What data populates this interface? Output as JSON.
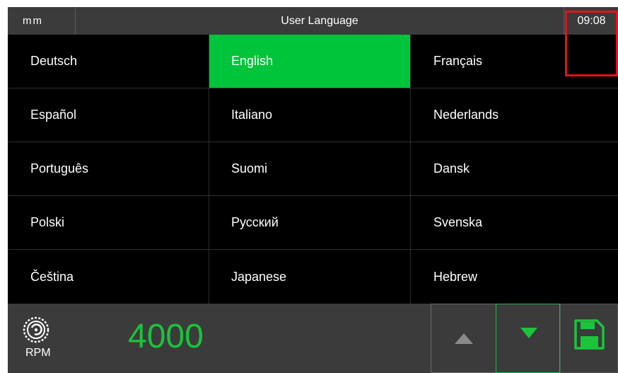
{
  "header": {
    "unit": "mm",
    "title": "User Language",
    "time": "09:08"
  },
  "languages": [
    [
      "Deutsch",
      "English",
      "Français"
    ],
    [
      "Español",
      "Italiano",
      "Nederlands"
    ],
    [
      "Português",
      "Suomi",
      "Dansk"
    ],
    [
      "Polski",
      "Русский",
      "Svenska"
    ],
    [
      "Čeština",
      "Japanese",
      "Hebrew"
    ]
  ],
  "selected_language": "English",
  "footer": {
    "rpm_label": "RPM",
    "rpm_value": "4000",
    "icons": {
      "rpm": "circular-saw-blade-icon",
      "up": "triangle-up-icon",
      "down": "triangle-down-icon",
      "save": "floppy-disk-save-icon"
    }
  },
  "colors": {
    "accent": "#00c43a",
    "header_bg": "#3b3b3b",
    "screen_bg": "#000000",
    "up_arrow_disabled": "#8a8a8a",
    "save_highlight": "#e0141b"
  }
}
